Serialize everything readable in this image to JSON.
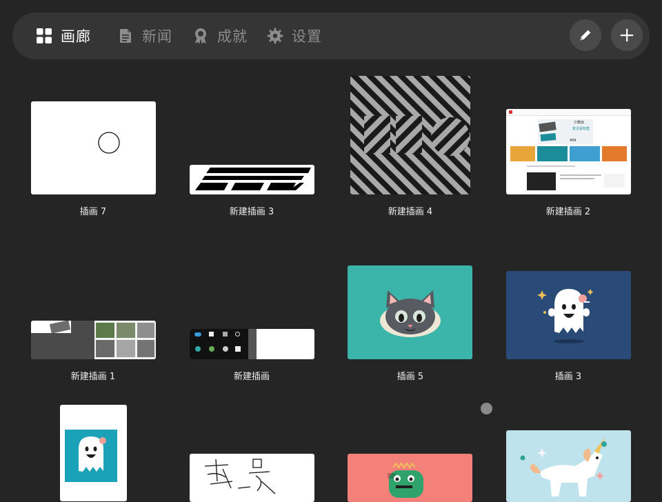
{
  "nav": {
    "tabs": [
      {
        "label": "画廊",
        "icon": "gallery-grid-icon",
        "active": true
      },
      {
        "label": "新闻",
        "icon": "news-document-icon",
        "active": false
      },
      {
        "label": "成就",
        "icon": "achievement-badge-icon",
        "active": false
      },
      {
        "label": "设置",
        "icon": "settings-gear-icon",
        "active": false
      }
    ],
    "actions": [
      {
        "icon": "pencil-icon"
      },
      {
        "icon": "plus-icon"
      }
    ]
  },
  "gallery": {
    "items": [
      {
        "title": "插画 7"
      },
      {
        "title": "新建插画 3"
      },
      {
        "title": "新建插画 4"
      },
      {
        "title": "新建插画 2"
      },
      {
        "title": "新建插画 1"
      },
      {
        "title": "新建插画"
      },
      {
        "title": "插画 5"
      },
      {
        "title": "插画 3"
      },
      {
        "title": ""
      },
      {
        "title": ""
      },
      {
        "title": ""
      },
      {
        "title": ""
      }
    ],
    "thumb_text": {
      "site_headline": "少数派",
      "site_sub": "复古鼠标垫",
      "site_price": "¥69"
    }
  },
  "colors": {
    "background": "#252525",
    "bar": "#353535",
    "teal_card": "#3bb5aa",
    "navy_card": "#2a4a78",
    "coral_card": "#f4807a",
    "lightblue_card": "#bfe3ec"
  }
}
